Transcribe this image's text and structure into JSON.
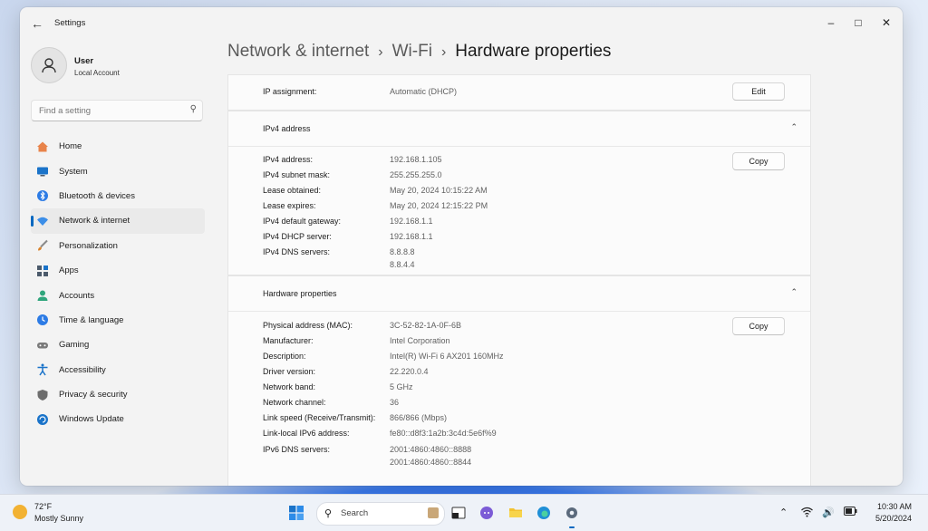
{
  "window": {
    "app_title": "Settings",
    "back_icon": "back-arrow-icon",
    "controls": [
      "minimize-icon",
      "maximize-icon",
      "close-icon"
    ]
  },
  "profile": {
    "name": "User",
    "account_type": "Local Account"
  },
  "search": {
    "placeholder": "Find a setting"
  },
  "nav": {
    "items": [
      {
        "label": "Home",
        "icon": "home-icon",
        "color": "#e8834a"
      },
      {
        "label": "System",
        "icon": "system-icon",
        "color": "#1a73c9"
      },
      {
        "label": "Bluetooth & devices",
        "icon": "bluetooth-icon",
        "color": "#2c7be5"
      },
      {
        "label": "Network & internet",
        "icon": "wifi-icon",
        "color": "#3b8ee8"
      },
      {
        "label": "Personalization",
        "icon": "brush-icon",
        "color": "#d9822b"
      },
      {
        "label": "Apps",
        "icon": "apps-icon",
        "color": "#4b5a6b"
      },
      {
        "label": "Accounts",
        "icon": "accounts-icon",
        "color": "#2fa57c"
      },
      {
        "label": "Time & language",
        "icon": "globe-clock-icon",
        "color": "#2c7be5"
      },
      {
        "label": "Gaming",
        "icon": "gamepad-icon",
        "color": "#7a7a7a"
      },
      {
        "label": "Accessibility",
        "icon": "accessibility-icon",
        "color": "#1a73c9"
      },
      {
        "label": "Privacy & security",
        "icon": "shield-icon",
        "color": "#6d6d6d"
      },
      {
        "label": "Windows Update",
        "icon": "update-icon",
        "color": "#1a73c9"
      }
    ],
    "active_index": 3
  },
  "breadcrumb": {
    "level1": "Network & internet",
    "level2": "Wi-Fi",
    "current": "Hardware properties"
  },
  "ip_assignment": {
    "label": "IP assignment:",
    "value": "Automatic (DHCP)",
    "button": "Edit"
  },
  "ipv4": {
    "title": "IPv4 address",
    "button": "Copy",
    "rows": [
      {
        "label": "IPv4 address:",
        "value": "192.168.1.105"
      },
      {
        "label": "IPv4 subnet mask:",
        "value": "255.255.255.0"
      },
      {
        "label": "Lease obtained:",
        "value": "May 20, 2024 10:15:22 AM"
      },
      {
        "label": "Lease expires:",
        "value": "May 20, 2024 12:15:22 PM"
      },
      {
        "label": "IPv4 default gateway:",
        "value": "192.168.1.1"
      },
      {
        "label": "IPv4 DHCP server:",
        "value": "192.168.1.1"
      },
      {
        "label": "IPv4 DNS servers:",
        "value": "8.8.8.8",
        "value2": "8.8.4.4"
      }
    ]
  },
  "hardware": {
    "title": "Hardware properties",
    "button": "Copy",
    "rows": [
      {
        "label": "Physical address (MAC):",
        "value": "3C-52-82-1A-0F-6B"
      },
      {
        "label": "Manufacturer:",
        "value": "Intel Corporation"
      },
      {
        "label": "Description:",
        "value": "Intel(R) Wi-Fi 6 AX201 160MHz"
      },
      {
        "label": "Driver version:",
        "value": "22.220.0.4"
      },
      {
        "label": "Network band:",
        "value": "5 GHz"
      },
      {
        "label": "Network channel:",
        "value": "36"
      },
      {
        "label": "Link speed (Receive/Transmit):",
        "value": "866/866 (Mbps)"
      },
      {
        "label": "Link-local IPv6 address:",
        "value": "fe80::d8f3:1a2b:3c4d:5e6f%9"
      },
      {
        "label": "IPv6 DNS servers:",
        "value": "2001:4860:4860::8888",
        "value2": "2001:4860:4860::8844"
      }
    ]
  },
  "taskbar": {
    "weather_temp": "72°F",
    "weather_desc": "Mostly Sunny",
    "search_label": "Search",
    "time": "10:30 AM",
    "date": "5/20/2024"
  }
}
